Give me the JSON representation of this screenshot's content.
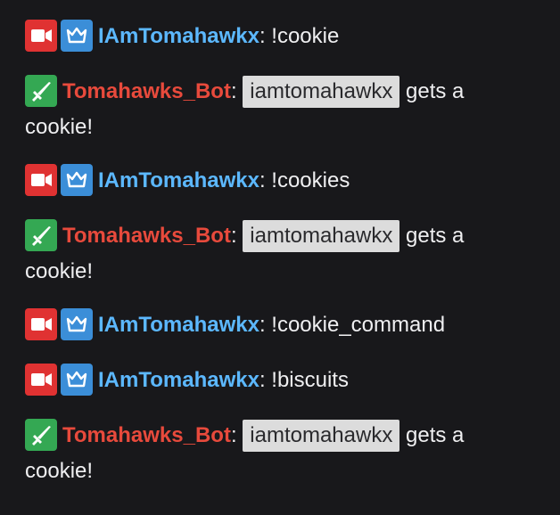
{
  "colors": {
    "background": "#18181b",
    "text": "#efeff1",
    "broadcaster_badge": "#e03232",
    "prime_badge": "#3b8ed8",
    "moderator_badge": "#34a853",
    "user_iamtomahawkx": "#5cb8ff",
    "user_bot": "#e84a3c"
  },
  "messages": [
    {
      "badges": [
        "broadcaster-icon",
        "crown-icon"
      ],
      "username": "IAmTomahawkx",
      "separator": ":",
      "text": "!cookie"
    },
    {
      "badges": [
        "sword-icon"
      ],
      "username": "Tomahawks_Bot",
      "separator": ":",
      "mention": "iamtomahawkx",
      "text": "gets a cookie!"
    },
    {
      "badges": [
        "broadcaster-icon",
        "crown-icon"
      ],
      "username": "IAmTomahawkx",
      "separator": ":",
      "text": "!cookies"
    },
    {
      "badges": [
        "sword-icon"
      ],
      "username": "Tomahawks_Bot",
      "separator": ":",
      "mention": "iamtomahawkx",
      "text": "gets a cookie!"
    },
    {
      "badges": [
        "broadcaster-icon",
        "crown-icon"
      ],
      "username": "IAmTomahawkx",
      "separator": ":",
      "text": "!cookie_command"
    },
    {
      "badges": [
        "broadcaster-icon",
        "crown-icon"
      ],
      "username": "IAmTomahawkx",
      "separator": ":",
      "text": "!biscuits"
    },
    {
      "badges": [
        "sword-icon"
      ],
      "username": "Tomahawks_Bot",
      "separator": ":",
      "mention": "iamtomahawkx",
      "text": "gets a cookie!"
    }
  ]
}
